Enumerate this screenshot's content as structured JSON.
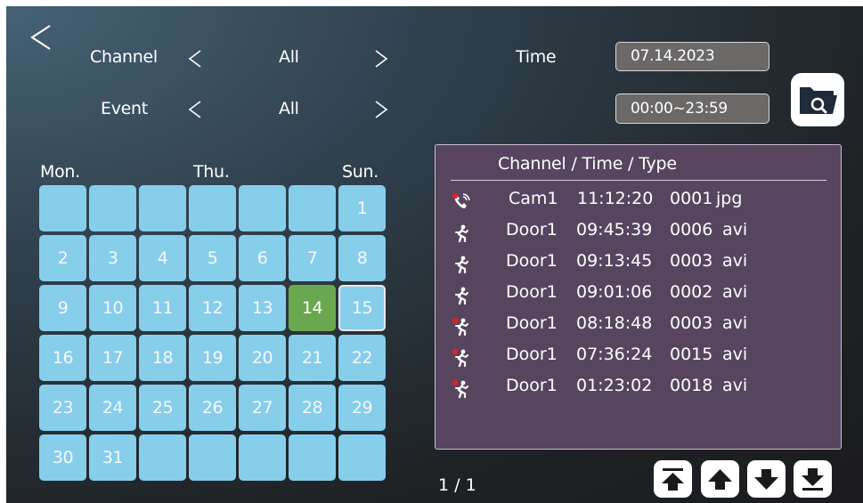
{
  "filter": {
    "channel_label": "Channel",
    "channel_value": "All",
    "event_label": "Event",
    "event_value": "All",
    "time_label": "Time",
    "date_value": "07.14.2023",
    "time_range_value": "00:00~23:59"
  },
  "calendar": {
    "headers": [
      "Mon.",
      "Thu.",
      "Sun."
    ],
    "today": "14",
    "selected": "15",
    "weeks": [
      [
        "",
        "",
        "",
        "",
        "",
        "",
        "1"
      ],
      [
        "2",
        "3",
        "4",
        "5",
        "6",
        "7",
        "8"
      ],
      [
        "9",
        "10",
        "11",
        "12",
        "13",
        "14",
        "15"
      ],
      [
        "16",
        "17",
        "18",
        "19",
        "20",
        "21",
        "22"
      ],
      [
        "23",
        "24",
        "25",
        "26",
        "27",
        "28",
        "29"
      ],
      [
        "30",
        "31",
        "",
        "",
        "",
        "",
        ""
      ]
    ]
  },
  "records": {
    "header": "Channel / Time / Type",
    "rows": [
      {
        "icon": "call-icon",
        "channel": "Cam1",
        "time": "11:12:20",
        "num": "0001",
        "type": "jpg",
        "new": true
      },
      {
        "icon": "running-person-icon",
        "channel": "Door1",
        "time": "09:45:39",
        "num": "0006",
        "type": "avi",
        "new": false
      },
      {
        "icon": "running-person-icon",
        "channel": "Door1",
        "time": "09:13:45",
        "num": "0003",
        "type": "avi",
        "new": false
      },
      {
        "icon": "running-person-icon",
        "channel": "Door1",
        "time": "09:01:06",
        "num": "0002",
        "type": "avi",
        "new": false
      },
      {
        "icon": "running-person-icon",
        "channel": "Door1",
        "time": "08:18:48",
        "num": "0003",
        "type": "avi",
        "new": true
      },
      {
        "icon": "running-person-icon",
        "channel": "Door1",
        "time": "07:36:24",
        "num": "0015",
        "type": "avi",
        "new": true
      },
      {
        "icon": "running-person-icon",
        "channel": "Door1",
        "time": "01:23:02",
        "num": "0018",
        "type": "avi",
        "new": true
      }
    ]
  },
  "pager": {
    "text": "1 / 1"
  },
  "colors": {
    "calendar_cell": "#87ceeb",
    "calendar_today": "#6aa84f",
    "panel_bg": "#57455f",
    "field_bg": "#6b6868",
    "new_marker": "#e02020"
  }
}
